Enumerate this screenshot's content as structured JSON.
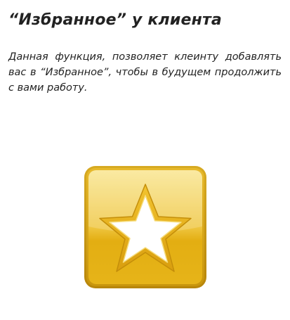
{
  "heading": {
    "title": "“Избранное” у клиента"
  },
  "content": {
    "description": "Данная функция, позволяет клеинту добавлять вас в “Избранное”, чтобы в будущем продолжить с вами работу."
  },
  "illustration": {
    "icon": "star-icon",
    "colors": {
      "frame": "#c99a0a",
      "tile_top": "#f7dc72",
      "tile_bottom": "#e1ad10",
      "star_fill": "#ffffff",
      "star_outline": "#e3a812"
    }
  }
}
